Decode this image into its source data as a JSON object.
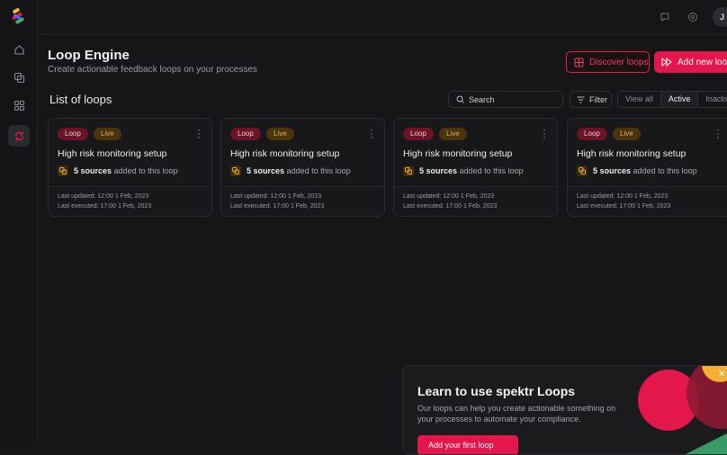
{
  "header": {
    "title": "Loop Engine",
    "subtitle": "Create actionable feedback loops on your processes",
    "discover_label": "Discover loops",
    "add_label": "Add new loop",
    "avatar_text": "J"
  },
  "list": {
    "title": "List of loops",
    "search_placeholder": "Search",
    "filter_label": "Filter",
    "views": [
      "View all",
      "Active",
      "Inactive"
    ],
    "active_view": "Active"
  },
  "cards": [
    {
      "tag_type": "Loop",
      "tag_status": "Live",
      "title": "High risk monitoring setup",
      "sources_count": "5 sources",
      "sources_suffix": "added to this loop",
      "last_updated": "Last updated: 12:00 1 Feb, 2023",
      "last_executed": "Last executed: 17:00 1 Feb, 2023"
    },
    {
      "tag_type": "Loop",
      "tag_status": "Live",
      "title": "High risk monitoring setup",
      "sources_count": "5 sources",
      "sources_suffix": "added to this loop",
      "last_updated": "Last updated: 12:00 1 Feb, 2023",
      "last_executed": "Last executed: 17:00 1 Feb, 2023"
    },
    {
      "tag_type": "Loop",
      "tag_status": "Live",
      "title": "High risk monitoring setup",
      "sources_count": "5 sources",
      "sources_suffix": "added to this loop",
      "last_updated": "Last updated: 12:00 1 Feb, 2023",
      "last_executed": "Last executed: 17:00 1 Feb, 2023"
    },
    {
      "tag_type": "Loop",
      "tag_status": "Live",
      "title": "High risk monitoring setup",
      "sources_count": "5 sources",
      "sources_suffix": "added to this loop",
      "last_updated": "Last updated: 12:00 1 Feb, 2023",
      "last_executed": "Last executed: 17:00 1 Feb, 2023"
    }
  ],
  "promo": {
    "title": "Learn to use spektr Loops",
    "text": "Our loops can help you create actionable something on your processes to automate your compliance.",
    "button_label": "Add your first loop"
  },
  "colors": {
    "accent": "#e3174b",
    "background": "#161618",
    "card": "#18181b",
    "live": "#e6a93a"
  }
}
